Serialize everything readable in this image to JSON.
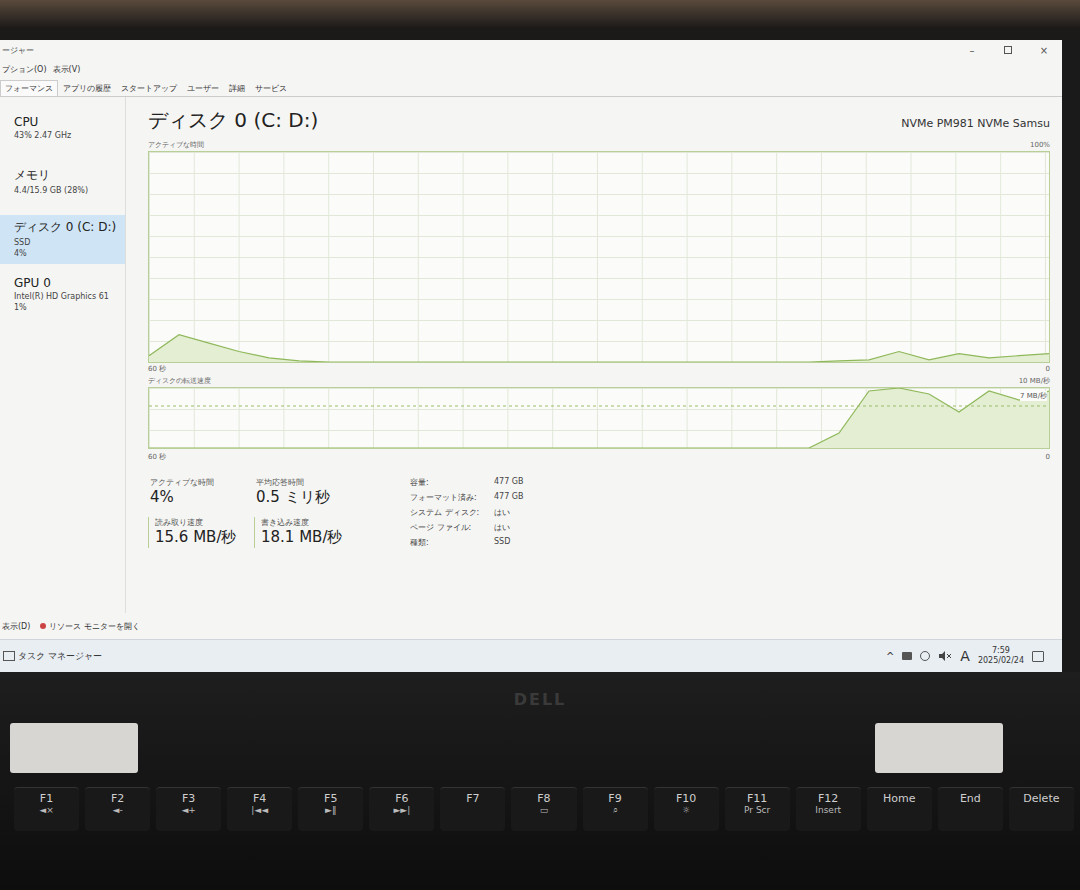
{
  "window": {
    "title": "ージャー",
    "controls": [
      "–",
      "×"
    ]
  },
  "menu": [
    "プション(O)",
    "表示(V)"
  ],
  "tabs": [
    {
      "label": "フォーマンス",
      "selected": true
    },
    {
      "label": "アプリの履歴",
      "selected": false
    },
    {
      "label": "スタートアップ",
      "selected": false
    },
    {
      "label": "ユーザー",
      "selected": false
    },
    {
      "label": "詳細",
      "selected": false
    },
    {
      "label": "サービス",
      "selected": false
    }
  ],
  "sidebar": {
    "items": [
      {
        "name": "CPU",
        "lines": [
          "43% 2.47 GHz"
        ],
        "selected": false
      },
      {
        "name": "メモリ",
        "lines": [
          "4.4/15.9 GB (28%)"
        ],
        "selected": false
      },
      {
        "name": "ディスク 0 (C: D:)",
        "lines": [
          "SSD",
          "4%"
        ],
        "selected": true
      },
      {
        "name": "GPU 0",
        "lines": [
          "Intel(R) HD Graphics 61",
          "1%"
        ],
        "selected": false
      }
    ]
  },
  "disk": {
    "title": "ディスク 0 (C: D:)",
    "model": "NVMe PM981 NVMe Samsu",
    "active_chart": {
      "label": "アクティブな時間",
      "max": "100%",
      "x_label": "60 秒",
      "min": "0",
      "values": [
        3,
        13,
        9,
        5,
        2,
        0.5,
        0,
        0,
        0,
        0,
        0,
        0,
        0,
        0,
        0,
        0,
        0,
        0,
        0,
        0,
        0,
        0,
        0,
        0.5,
        1,
        5,
        1,
        4,
        2,
        3,
        4
      ]
    },
    "transfer_chart": {
      "label": "ディスクの転送速度",
      "max": "10 MB/秒",
      "marker": "7 MB/秒",
      "x_label": "60 秒",
      "min": "0",
      "values": [
        0,
        0,
        0,
        0,
        0,
        0,
        0,
        0,
        0,
        0,
        0,
        0,
        0,
        0,
        0,
        0,
        0,
        0,
        0,
        0,
        0,
        0,
        0,
        2.5,
        9.5,
        10,
        9,
        6,
        9.5,
        8,
        9.5
      ]
    },
    "stats": [
      {
        "label": "アクティブな時間",
        "value": "4%",
        "kind": "plain"
      },
      {
        "label": "平均応答時間",
        "value": "0.5 ミリ秒",
        "kind": "plain"
      },
      {
        "label": "読み取り速度",
        "value": "15.6 MB/秒",
        "kind": "rate"
      },
      {
        "label": "書き込み速度",
        "value": "18.1 MB/秒",
        "kind": "rate"
      }
    ],
    "properties": [
      {
        "label": "容量:",
        "value": "477 GB"
      },
      {
        "label": "フォーマット済み:",
        "value": "477 GB"
      },
      {
        "label": "システム ディスク:",
        "value": "はい"
      },
      {
        "label": "ページ ファイル:",
        "value": "はい"
      },
      {
        "label": "種類:",
        "value": "SSD"
      }
    ]
  },
  "footer": {
    "links": [
      "表示(D)",
      "リソース モニターを開く"
    ]
  },
  "taskbar": {
    "app": "タスク マネージャー",
    "tray": [
      "^"
    ],
    "ime": "A",
    "time": "7:59",
    "date": "2025/02/24"
  },
  "laptop": {
    "logo": "DELL",
    "keys": [
      {
        "label": "F1",
        "sub": "◄×"
      },
      {
        "label": "F2",
        "sub": "◄-"
      },
      {
        "label": "F3",
        "sub": "◄+"
      },
      {
        "label": "F4",
        "sub": "|◄◄"
      },
      {
        "label": "F5",
        "sub": "►‖"
      },
      {
        "label": "F6",
        "sub": "►►|"
      },
      {
        "label": "F7",
        "sub": ""
      },
      {
        "label": "F8",
        "sub": "▭"
      },
      {
        "label": "F9",
        "sub": "⌕"
      },
      {
        "label": "F10",
        "sub": "☼"
      },
      {
        "label": "F11",
        "sub": "Pr Scr"
      },
      {
        "label": "F12",
        "sub": "Insert"
      },
      {
        "label": "Home",
        "sub": ""
      },
      {
        "label": "End",
        "sub": ""
      },
      {
        "label": "Delete",
        "sub": ""
      }
    ]
  }
}
